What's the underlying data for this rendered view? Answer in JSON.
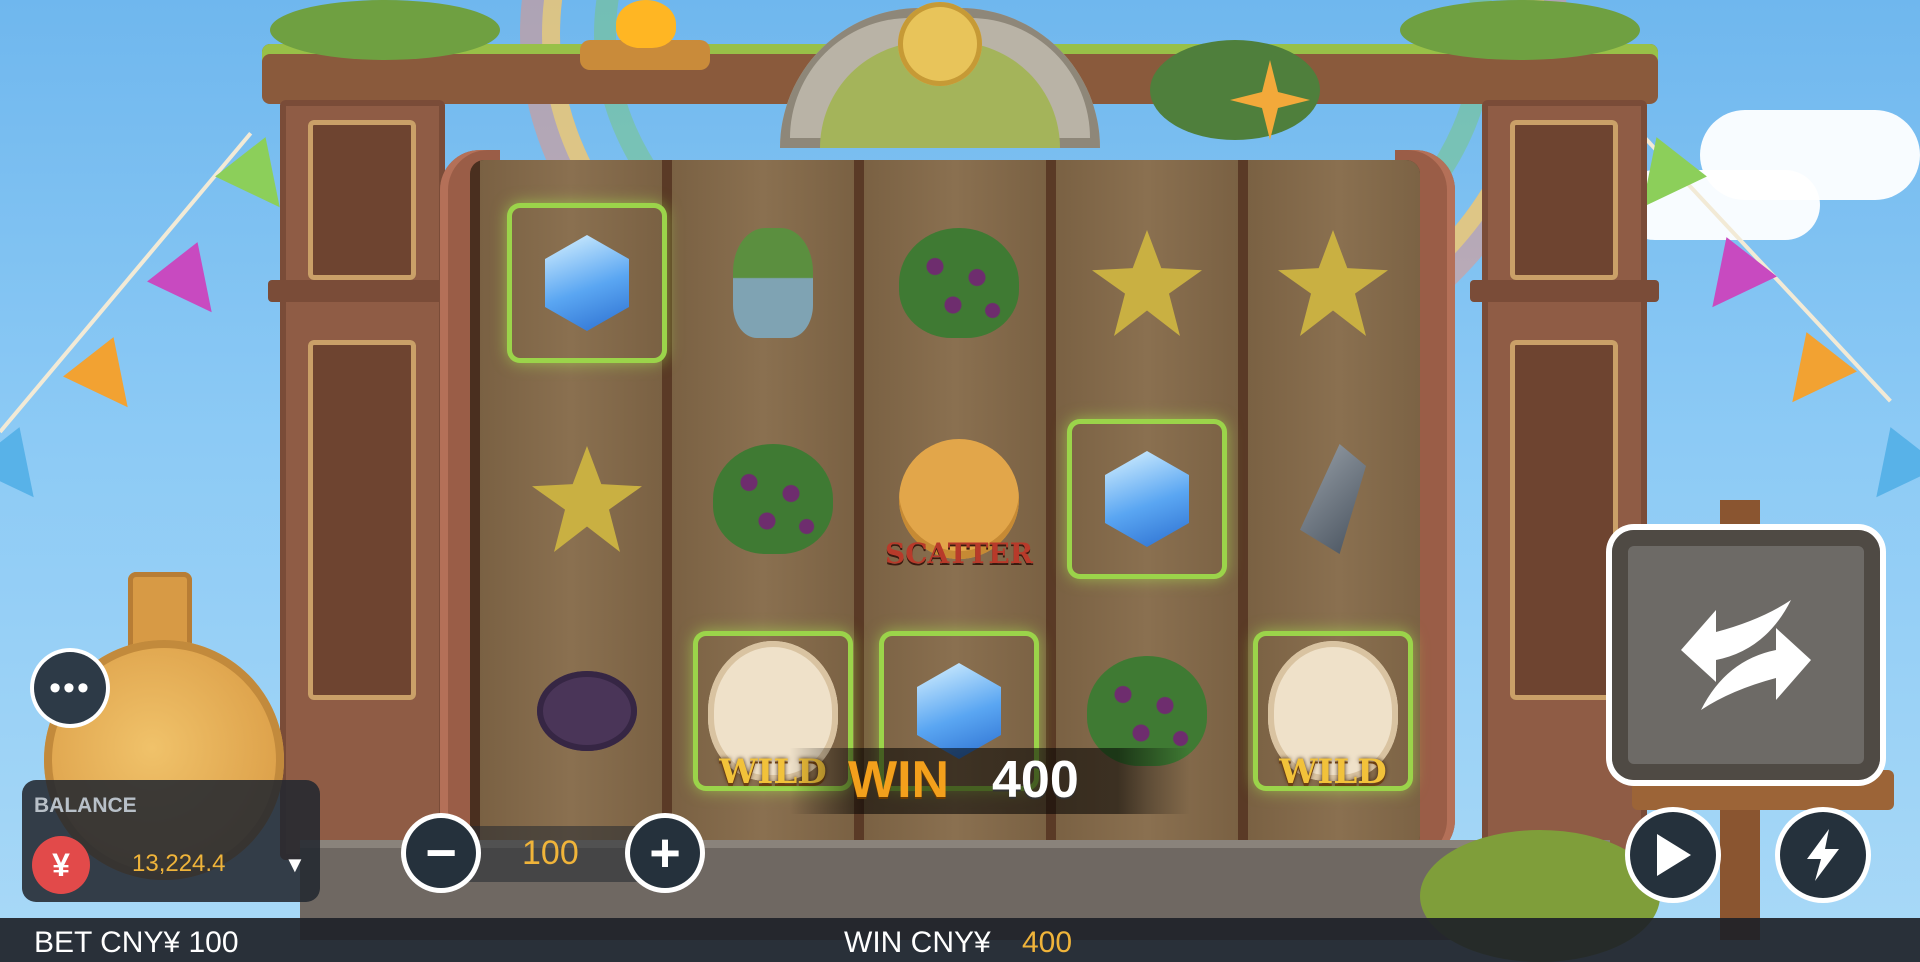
{
  "game": {
    "win_label": "WIN",
    "win_amount": "400",
    "reels": [
      [
        {
          "symbol": "diamond",
          "highlighted": true
        },
        {
          "symbol": "star",
          "highlighted": false
        },
        {
          "symbol": "spider",
          "highlighted": false
        }
      ],
      [
        {
          "symbol": "potted-plant",
          "highlighted": false
        },
        {
          "symbol": "berry-bush",
          "highlighted": false
        },
        {
          "symbol": "wild",
          "label": "WILD",
          "highlighted": true
        }
      ],
      [
        {
          "symbol": "berry-bush",
          "highlighted": false
        },
        {
          "symbol": "scatter",
          "label": "SCATTER",
          "highlighted": false
        },
        {
          "symbol": "diamond",
          "highlighted": true
        }
      ],
      [
        {
          "symbol": "star",
          "highlighted": false
        },
        {
          "symbol": "diamond",
          "highlighted": true
        },
        {
          "symbol": "berry-bush",
          "highlighted": false
        }
      ],
      [
        {
          "symbol": "star",
          "highlighted": false
        },
        {
          "symbol": "stone",
          "highlighted": false
        },
        {
          "symbol": "wild",
          "label": "WILD",
          "highlighted": true
        }
      ]
    ]
  },
  "controls": {
    "menu_icon": "ellipsis-icon",
    "balance_label": "BALANCE",
    "currency_symbol": "¥",
    "balance_value": "13,224.4",
    "balance_dropdown": "▼",
    "bet_minus": "−",
    "bet_value": "100",
    "bet_plus": "+",
    "spin_icon": "spin-arrows-icon",
    "autoplay_icon": "play-icon",
    "turbo_icon": "lightning-icon"
  },
  "bottom_bar": {
    "bet_text": "BET CNY¥ 100",
    "win_label": "WIN CNY¥",
    "win_value": "400"
  },
  "colors": {
    "highlight": "#9bd44a",
    "win_label": "#f3a01c",
    "accent_value": "#f0b43a",
    "button_bg": "#25313c"
  }
}
